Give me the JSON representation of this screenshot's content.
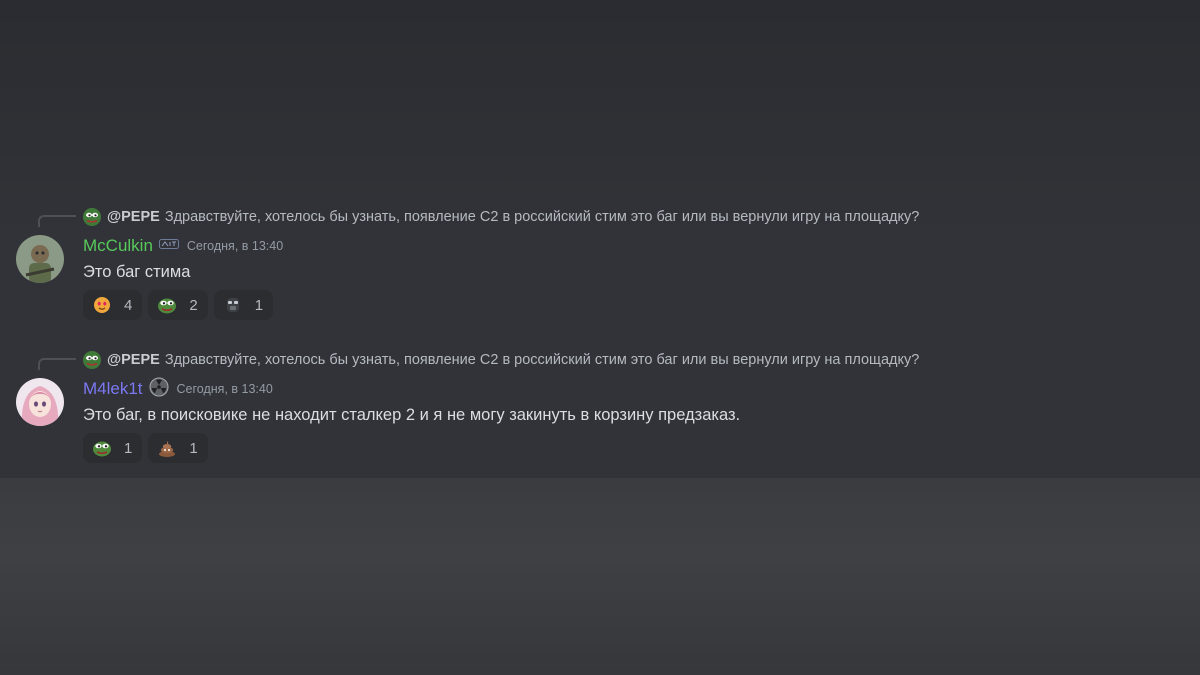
{
  "messages": [
    {
      "reply": {
        "username": "@PEPE",
        "text": "Здравствуйте, хотелось бы узнать, появление С2 в российский стим это баг или вы вернули игру на площадку?"
      },
      "username": "McCulkin",
      "username_color": "#57c95a",
      "timestamp": "Сегодня, в 13:40",
      "content": "Это баг стима",
      "reactions": [
        {
          "emoji": "heart-face-emoji",
          "count": "4"
        },
        {
          "emoji": "pepe-frog-emoji",
          "count": "2"
        },
        {
          "emoji": "stalker-mask-emoji",
          "count": "1"
        }
      ]
    },
    {
      "reply": {
        "username": "@PEPE",
        "text": "Здравствуйте, хотелось бы узнать, появление С2 в российский стим это баг или вы вернули игру на площадку?"
      },
      "username": "M4lek1t",
      "username_color": "#7b78f2",
      "timestamp": "Сегодня, в 13:40",
      "content": "Это баг, в поисковике не находит сталкер 2 и я не могу закинуть в корзину предзаказ.",
      "reactions": [
        {
          "emoji": "pepe-frog-emoji",
          "count": "1"
        },
        {
          "emoji": "poop-emoji",
          "count": "1"
        }
      ]
    }
  ]
}
